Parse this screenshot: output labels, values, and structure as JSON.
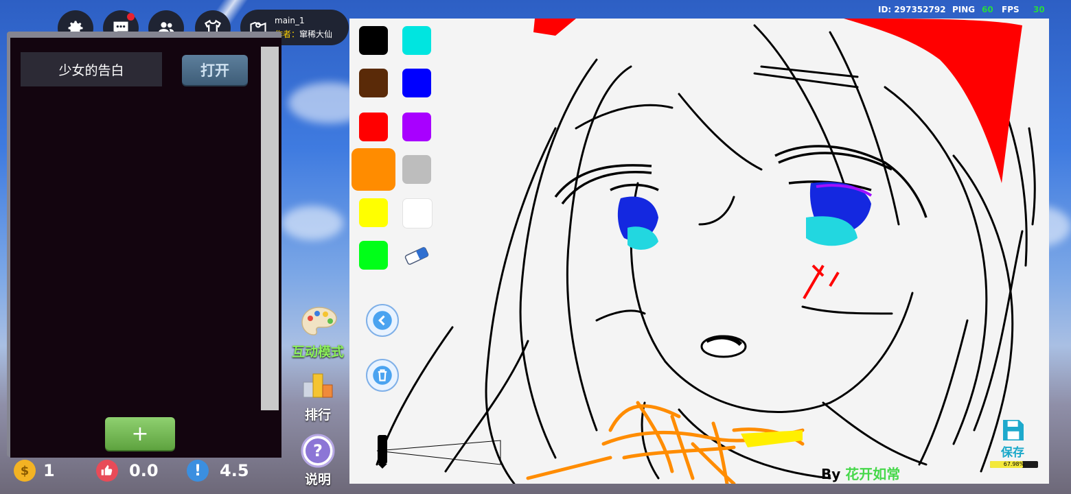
{
  "topbar": {
    "icons": [
      "gear-icon",
      "chat-icon",
      "friends-icon",
      "wardrobe-icon"
    ],
    "map_name": "main_1",
    "author_label": "作者：",
    "author_name": "窜稀大仙",
    "id_text": "ID: 297352792",
    "ping_label": "PING",
    "ping_value": "60",
    "fps_label": "FPS",
    "fps_value": "30"
  },
  "panel": {
    "title": "少女的告白",
    "open_label": "打开",
    "add_label": "+"
  },
  "stats": {
    "coins": "1",
    "likes": "0.0",
    "rating": "4.5"
  },
  "side_tools": {
    "interact_label": "互动模式",
    "rank_label": "排行",
    "help_label": "说明"
  },
  "canvas": {
    "colors": [
      {
        "hex": "#000000"
      },
      {
        "hex": "#00e5e0"
      },
      {
        "hex": "#5a2a08"
      },
      {
        "hex": "#0000ff"
      },
      {
        "hex": "#ff0000"
      },
      {
        "hex": "#a800ff"
      },
      {
        "hex": "#ff8c00",
        "selected": true
      },
      {
        "hex": "#bdbdbd"
      },
      {
        "hex": "#ffff00"
      },
      {
        "hex": "#ffffff"
      },
      {
        "hex": "#00ff18"
      }
    ],
    "by_label": "By",
    "by_name": "花开如常",
    "save_label": "保存",
    "save_progress": 0.6798,
    "save_progress_text": "67.98%"
  }
}
